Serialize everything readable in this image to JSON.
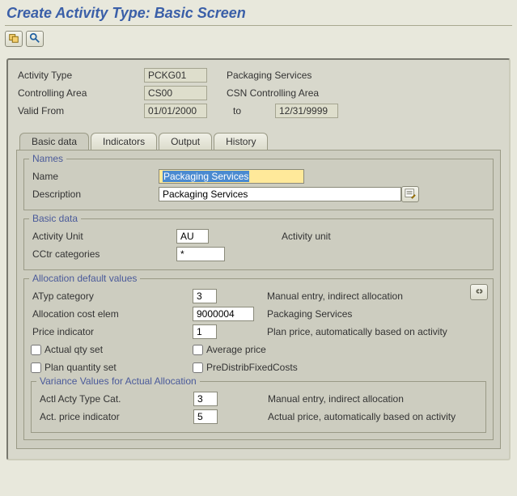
{
  "screen": {
    "title": "Create Activity Type: Basic Screen"
  },
  "toolbar": {
    "icon_other_object": "other-object-icon",
    "icon_analyze": "analyze-icon"
  },
  "header": {
    "activity_type_label": "Activity Type",
    "activity_type_value": "PCKG01",
    "activity_type_desc": "Packaging Services",
    "controlling_area_label": "Controlling Area",
    "controlling_area_value": "CS00",
    "controlling_area_desc": "CSN Controlling Area",
    "valid_from_label": "Valid From",
    "valid_from_value": "01/01/2000",
    "to_label": "to",
    "valid_to_value": "12/31/9999"
  },
  "tabs": [
    {
      "label": "Basic data"
    },
    {
      "label": "Indicators"
    },
    {
      "label": "Output"
    },
    {
      "label": "History"
    }
  ],
  "names_group": {
    "legend": "Names",
    "name_label": "Name",
    "name_value": "Packaging Services",
    "desc_label": "Description",
    "desc_value": "Packaging Services",
    "edit_icon": "pencil-icon"
  },
  "basic_group": {
    "legend": "Basic data",
    "activity_unit_label": "Activity Unit",
    "activity_unit_value": "AU",
    "activity_unit_desc": "Activity unit",
    "cctr_categories_label": "CCtr categories",
    "cctr_categories_value": "*"
  },
  "alloc_group": {
    "legend": "Allocation default values",
    "atyp_label": "ATyp category",
    "atyp_value": "3",
    "atyp_desc": "Manual entry, indirect allocation",
    "cost_elem_label": "Allocation cost elem",
    "cost_elem_value": "9000004",
    "cost_elem_desc": "Packaging Services",
    "price_ind_label": "Price indicator",
    "price_ind_value": "1",
    "price_ind_desc": "Plan price, automatically based on activity",
    "actual_qty_label": "Actual qty set",
    "avg_price_label": "Average price",
    "plan_qty_label": "Plan quantity set",
    "predistrib_label": "PreDistribFixedCosts",
    "link_icon": "link-icon",
    "variance": {
      "legend": "Variance Values for Actual Allocation",
      "actl_type_label": "Actl Acty Type Cat.",
      "actl_type_value": "3",
      "actl_type_desc": "Manual entry, indirect allocation",
      "act_price_ind_label": "Act. price indicator",
      "act_price_ind_value": "5",
      "act_price_ind_desc": "Actual price, automatically based on activity"
    }
  }
}
